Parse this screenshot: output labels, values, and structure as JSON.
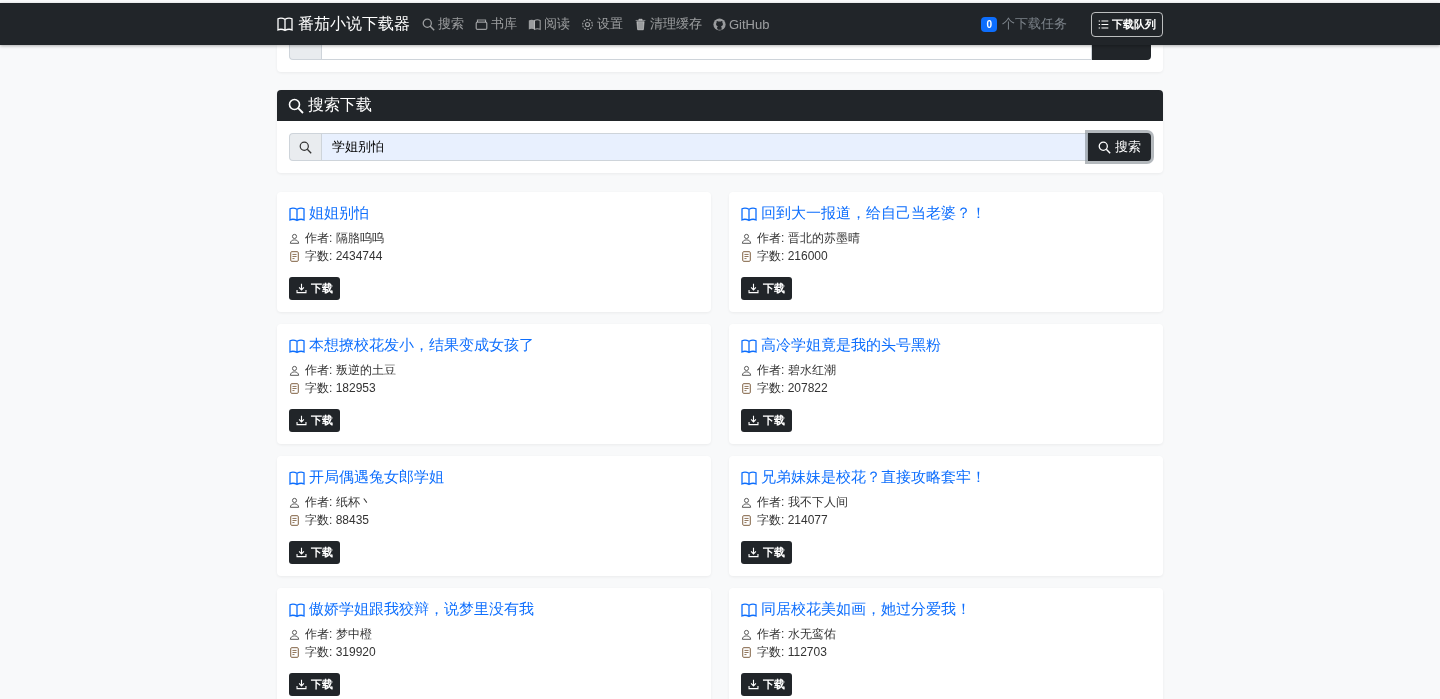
{
  "navbar": {
    "brand": "番茄小说下载器",
    "links": [
      {
        "kind": "search",
        "label": "搜索"
      },
      {
        "kind": "library",
        "label": "书库"
      },
      {
        "kind": "read",
        "label": "阅读"
      },
      {
        "kind": "settings",
        "label": "设置"
      },
      {
        "kind": "trash",
        "label": "清理缓存"
      },
      {
        "kind": "github",
        "label": "GitHub"
      }
    ],
    "task_count": "0",
    "task_label": "个下载任务",
    "queue_button": "下载队列"
  },
  "search_panel": {
    "title": "搜索下载",
    "query": "学姐别怕",
    "button": "搜索"
  },
  "results": [
    {
      "title": "姐姐别怕",
      "author": "作者: 隔胳呜呜",
      "words": "字数: 2434744",
      "button": "下载"
    },
    {
      "title": "回到大一报道，给自己当老婆？！",
      "author": "作者: 晋北的苏墨晴",
      "words": "字数: 216000",
      "button": "下载"
    },
    {
      "title": "本想撩校花发小，结果变成女孩了",
      "author": "作者: 叛逆的土豆",
      "words": "字数: 182953",
      "button": "下载"
    },
    {
      "title": "高冷学姐竟是我的头号黑粉",
      "author": "作者: 碧水红潮",
      "words": "字数: 207822",
      "button": "下载"
    },
    {
      "title": "开局偶遇兔女郎学姐",
      "author": "作者: 纸杯丶",
      "words": "字数: 88435",
      "button": "下载"
    },
    {
      "title": "兄弟妹妹是校花？直接攻略套牢！",
      "author": "作者: 我不下人间",
      "words": "字数: 214077",
      "button": "下载"
    },
    {
      "title": "傲娇学姐跟我狡辩，说梦里没有我",
      "author": "作者: 梦中橙",
      "words": "字数: 319920",
      "button": "下载"
    },
    {
      "title": "同居校花美如画，她过分爱我！",
      "author": "作者: 水无鸾佑",
      "words": "字数: 112703",
      "button": "下载"
    }
  ]
}
